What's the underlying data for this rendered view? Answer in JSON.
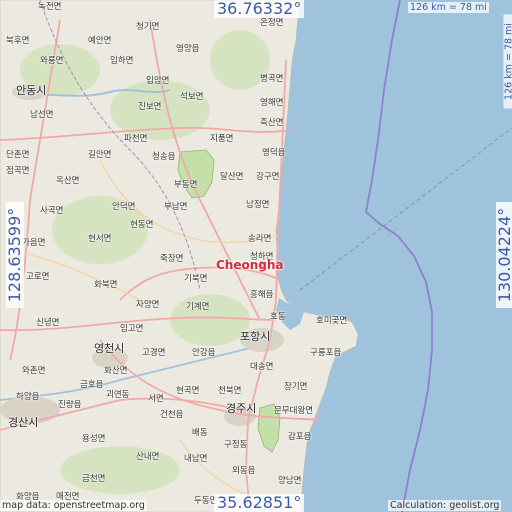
{
  "title": "Cheongha",
  "coordinates": {
    "lat_top": "36.76332°",
    "lat_bottom": "35.62851°",
    "lon_left": "128.63599°",
    "lon_right": "130.04224°"
  },
  "scale": {
    "horizontal": "126 km = 78 mi",
    "vertical": "126 km = 78 mi"
  },
  "attribution": "map data: openstreetmap.org",
  "calculation": "Calculation: geolist.org",
  "colors": {
    "land": "#eceae0",
    "sea": "#9fc3dc",
    "park": "#c4dfa8",
    "road": "#f0a9a9",
    "target": "#d9293b",
    "coord": "#3a5ca8"
  },
  "places": [
    {
      "name": "녹전면"
    },
    {
      "name": "청기면"
    },
    {
      "name": "온정면"
    },
    {
      "name": "북후면"
    },
    {
      "name": "예안면"
    },
    {
      "name": "영양읍"
    },
    {
      "name": "와룡면"
    },
    {
      "name": "임하면"
    },
    {
      "name": "입암면"
    },
    {
      "name": "병곡면"
    },
    {
      "name": "안동시"
    },
    {
      "name": "진보면"
    },
    {
      "name": "석보면"
    },
    {
      "name": "영해면"
    },
    {
      "name": "남선면"
    },
    {
      "name": "축산면"
    },
    {
      "name": "파천면"
    },
    {
      "name": "지품면"
    },
    {
      "name": "단촌면"
    },
    {
      "name": "길안면"
    },
    {
      "name": "청송읍"
    },
    {
      "name": "영덕읍"
    },
    {
      "name": "점곡면"
    },
    {
      "name": "부동면"
    },
    {
      "name": "옥산면"
    },
    {
      "name": "달산면"
    },
    {
      "name": "강구면"
    },
    {
      "name": "사곡면"
    },
    {
      "name": "안덕면"
    },
    {
      "name": "부남면"
    },
    {
      "name": "남정면"
    },
    {
      "name": "가음면"
    },
    {
      "name": "현서면"
    },
    {
      "name": "현동면"
    },
    {
      "name": "송라면"
    },
    {
      "name": "죽장면"
    },
    {
      "name": "청하면"
    },
    {
      "name": "고로면"
    },
    {
      "name": "기북면"
    },
    {
      "name": "화북면"
    },
    {
      "name": "흥해읍"
    },
    {
      "name": "자양면"
    },
    {
      "name": "기계면"
    },
    {
      "name": "신녕면"
    },
    {
      "name": "임고면"
    },
    {
      "name": "호동"
    },
    {
      "name": "호미곶면"
    },
    {
      "name": "영천시"
    },
    {
      "name": "고경면"
    },
    {
      "name": "안강읍"
    },
    {
      "name": "포항시"
    },
    {
      "name": "구룡포읍"
    },
    {
      "name": "화산면"
    },
    {
      "name": "금호읍"
    },
    {
      "name": "대송면"
    },
    {
      "name": "와촌면"
    },
    {
      "name": "하양읍"
    },
    {
      "name": "괴연동"
    },
    {
      "name": "현곡면"
    },
    {
      "name": "천북면"
    },
    {
      "name": "장기면"
    },
    {
      "name": "경산시"
    },
    {
      "name": "진량읍"
    },
    {
      "name": "서면"
    },
    {
      "name": "경주시"
    },
    {
      "name": "문무대왕면"
    },
    {
      "name": "건천읍"
    },
    {
      "name": "배동"
    },
    {
      "name": "감포읍"
    },
    {
      "name": "용성면"
    },
    {
      "name": "구정동"
    },
    {
      "name": "산내면"
    },
    {
      "name": "내남면"
    },
    {
      "name": "금천면"
    },
    {
      "name": "외동읍"
    },
    {
      "name": "양남면"
    },
    {
      "name": "화양읍"
    },
    {
      "name": "매전면"
    },
    {
      "name": "두동면"
    }
  ]
}
